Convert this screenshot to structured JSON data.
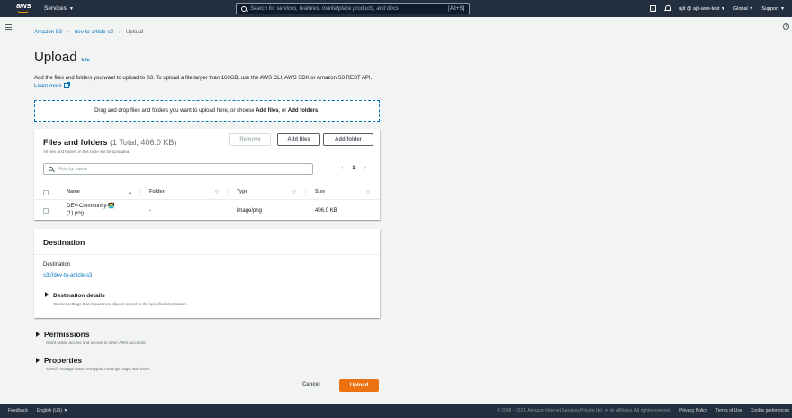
{
  "topnav": {
    "logo_text": "aws",
    "services_label": "Services",
    "search_placeholder": "Search for services, features, marketplace products, and docs",
    "search_shortcut": "[Alt+S]",
    "account_label": "ajit @ ajit-aws-test",
    "region_label": "Global",
    "support_label": "Support",
    "accent_color": "#ff9900"
  },
  "breadcrumbs": [
    "Amazon S3",
    "dev-to-article-s3",
    "Upload"
  ],
  "page": {
    "title": "Upload",
    "info_label": "Info",
    "intro": "Add the files and folders you want to upload to S3. To upload a file larger than 160GB, use the AWS CLI, AWS SDK or Amazon S3 REST API.",
    "learn_more": "Learn more"
  },
  "dropzone": {
    "prefix": "Drag and drop files and folders you want to upload here, or choose ",
    "add_files": "Add files",
    "mid": ", or ",
    "add_folders": "Add folders",
    "suffix": "."
  },
  "files_panel": {
    "title": "Files and folders",
    "count": "(1 Total, 406.0 KB)",
    "subtitle": "All files and folders in this table will be uploaded.",
    "remove_label": "Remove",
    "add_files_label": "Add files",
    "add_folder_label": "Add folder",
    "filter_placeholder": "Find by name",
    "page_number": "1",
    "columns": [
      "Name",
      "Folder",
      "Type",
      "Size"
    ],
    "rows": [
      {
        "name_line1": "DEV-Community-👨‍💻",
        "name_line2": "(1).png",
        "folder": "-",
        "type": "image/png",
        "size": "406.0 KB"
      }
    ]
  },
  "destination": {
    "title": "Destination",
    "label": "Destination",
    "value": "s3://dev-to-article-s3",
    "details_title": "Destination details",
    "details_sub": "Bucket settings that impact new objects stored in the specified destination."
  },
  "permissions": {
    "title": "Permissions",
    "sub": "Grant public access and access to other AWS accounts."
  },
  "properties": {
    "title": "Properties",
    "sub": "Specify storage class, encryption settings, tags, and more."
  },
  "actions": {
    "cancel_label": "Cancel",
    "upload_label": "Upload",
    "primary_color": "#ec7211"
  },
  "footer": {
    "feedback": "Feedback",
    "language": "English (US)",
    "copyright": "© 2008 - 2021, Amazon Internet Services Private Ltd. or its affiliates. All rights reserved.",
    "privacy": "Privacy Policy",
    "terms": "Terms of Use",
    "cookies": "Cookie preferences"
  }
}
